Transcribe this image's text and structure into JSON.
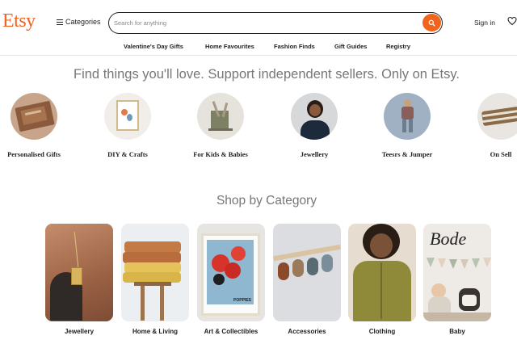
{
  "header": {
    "logo": "Etsy",
    "categories_label": "Categories",
    "search_placeholder": "Search for anything",
    "signin_label": "Sign in"
  },
  "nav": {
    "items": [
      "Valentine's Day Gifts",
      "Home Favourites",
      "Fashion Finds",
      "Gift Guides",
      "Registry"
    ]
  },
  "tagline": "Find things you'll love. Support independent sellers. Only on Etsy.",
  "circles": [
    {
      "label": "Personalised Gifts"
    },
    {
      "label": "DIY & Crafts"
    },
    {
      "label": "For Kids & Babies"
    },
    {
      "label": "Jewellery"
    },
    {
      "label": "Teesrs & Jumper"
    },
    {
      "label": "On Sell"
    }
  ],
  "shop_by_category": {
    "title": "Shop by Category",
    "items": [
      {
        "label": "Jewellery"
      },
      {
        "label": "Home & Living"
      },
      {
        "label": "Art & Collectibles",
        "image_text": "POPPIES"
      },
      {
        "label": "Accessories"
      },
      {
        "label": "Clothing"
      },
      {
        "label": "Baby",
        "image_text": "Bode"
      }
    ]
  },
  "colors": {
    "brand": "#f1641e",
    "text": "#222222",
    "muted": "#777777"
  }
}
